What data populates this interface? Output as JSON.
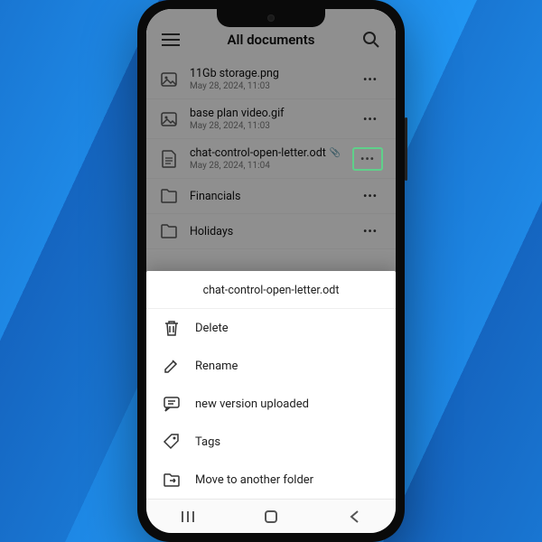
{
  "header": {
    "title": "All documents"
  },
  "files": [
    {
      "name": "11Gb storage.png",
      "date": "May 28, 2024, 11:03",
      "type": "image"
    },
    {
      "name": "base plan video.gif",
      "date": "May 28, 2024, 11:03",
      "type": "image"
    },
    {
      "name": "chat-control-open-letter.odt",
      "date": "May 28, 2024, 11:04",
      "type": "doc",
      "badges": true,
      "highlight": true
    },
    {
      "name": "Financials",
      "date": "",
      "type": "folder"
    },
    {
      "name": "Holidays",
      "date": "",
      "type": "folder"
    }
  ],
  "sheet": {
    "title": "chat-control-open-letter.odt",
    "items": [
      {
        "label": "Delete",
        "icon": "trash"
      },
      {
        "label": "Rename",
        "icon": "rename"
      },
      {
        "label": "new version uploaded",
        "icon": "comment"
      },
      {
        "label": "Tags",
        "icon": "tag"
      },
      {
        "label": "Move to another folder",
        "icon": "move"
      }
    ]
  }
}
